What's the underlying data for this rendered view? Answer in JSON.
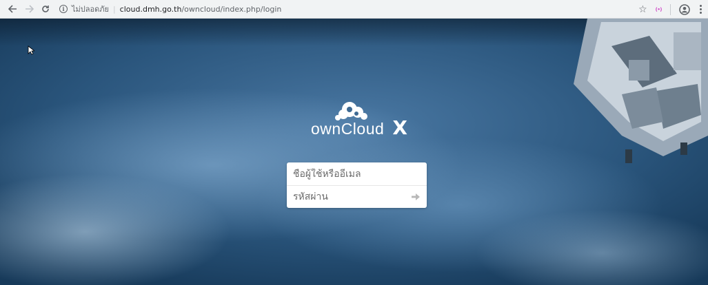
{
  "browser": {
    "security_text": "ไม่ปลอดภัย",
    "separator": "|",
    "url_host": "cloud.dmh.go.th",
    "url_path": "/owncloud/index.php/login",
    "icons": {
      "back": "arrow-left-icon",
      "forward": "arrow-right-icon",
      "reload": "reload-icon",
      "info": "info-icon",
      "star": "star-icon",
      "extension": "extension-icon",
      "profile": "profile-icon",
      "menu": "menu-icon"
    },
    "extension_text": "(•)"
  },
  "page": {
    "logo_text": "ownCloud",
    "logo_mark": "X",
    "login": {
      "username_placeholder": "ชื่อผู้ใช้หรืออีเมล",
      "password_placeholder": "รหัสผ่าน",
      "submit_icon": "arrow-right-icon"
    }
  },
  "colors": {
    "toolbar_bg": "#f1f3f4",
    "form_bg": "#ffffff",
    "logo": "#ffffff",
    "page_bg": "#2a557c"
  }
}
